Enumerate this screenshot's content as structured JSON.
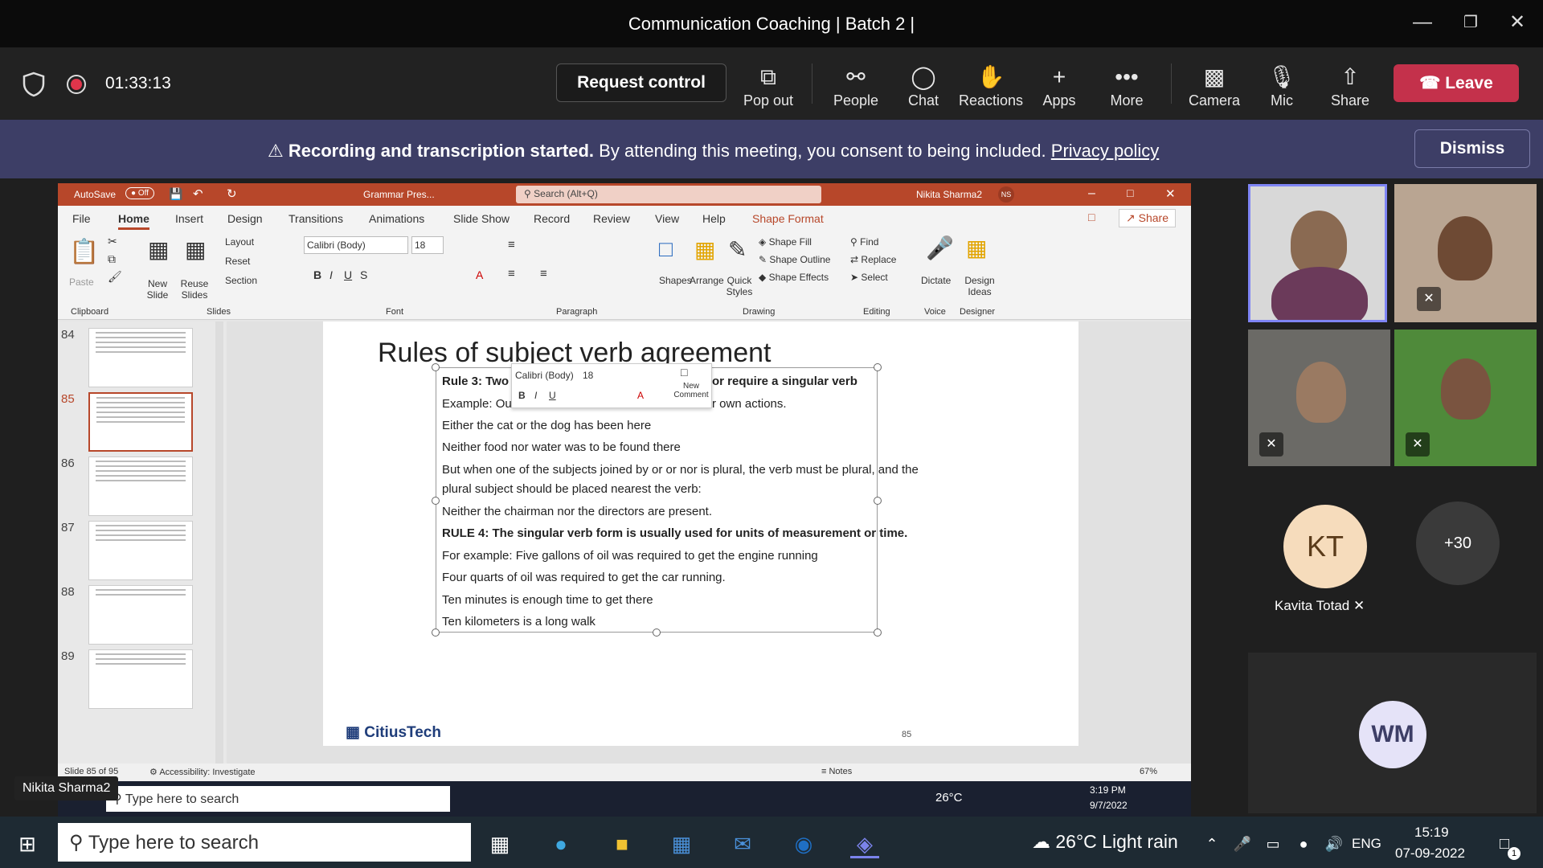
{
  "window": {
    "title": "Communication Coaching | Batch 2 |"
  },
  "meeting": {
    "timer": "01:33:13",
    "request_control": "Request control",
    "buttons": [
      {
        "label": "Pop out",
        "icon": "pop-out-icon"
      },
      {
        "label": "People",
        "icon": "people-icon"
      },
      {
        "label": "Chat",
        "icon": "chat-icon"
      },
      {
        "label": "Reactions",
        "icon": "reactions-icon"
      },
      {
        "label": "Apps",
        "icon": "apps-icon"
      },
      {
        "label": "More",
        "icon": "more-icon"
      },
      {
        "label": "Camera",
        "icon": "camera-off-icon"
      },
      {
        "label": "Mic",
        "icon": "mic-off-icon"
      },
      {
        "label": "Share",
        "icon": "share-icon"
      }
    ],
    "leave": "Leave"
  },
  "banner": {
    "bold": "Recording and transcription started.",
    "text": "By attending this meeting, you consent to being included.",
    "link": "Privacy policy",
    "dismiss": "Dismiss"
  },
  "presenter": {
    "name": "Nikita Sharma2"
  },
  "powerpoint": {
    "autosave": "AutoSave",
    "autosave_state": "Off",
    "doc_title": "Grammar Pres...",
    "search": "Search (Alt+Q)",
    "user": "Nikita Sharma2",
    "user_initials": "NS",
    "share": "Share",
    "tabs": [
      "File",
      "Home",
      "Insert",
      "Design",
      "Transitions",
      "Animations",
      "Slide Show",
      "Record",
      "Review",
      "View",
      "Help",
      "Shape Format"
    ],
    "ribbon": {
      "paste": "Paste",
      "clipboard": "Clipboard",
      "new_slide": "New Slide",
      "reuse_slides": "Reuse Slides",
      "layout": "Layout",
      "reset": "Reset",
      "section": "Section",
      "slides": "Slides",
      "font_name": "Calibri (Body)",
      "font_size": "18",
      "font": "Font",
      "paragraph": "Paragraph",
      "shapes": "Shapes",
      "arrange": "Arrange",
      "quick_styles": "Quick Styles",
      "shape_fill": "Shape Fill",
      "shape_outline": "Shape Outline",
      "shape_effects": "Shape Effects",
      "drawing": "Drawing",
      "find": "Find",
      "replace": "Replace",
      "select": "Select",
      "editing": "Editing",
      "dictate": "Dictate",
      "voice": "Voice",
      "design_ideas": "Design Ideas",
      "designer": "Designer"
    },
    "thumbnails": [
      "84",
      "85",
      "86",
      "87",
      "88",
      "89"
    ],
    "slide": {
      "title": "Rules of subject verb agreement",
      "lines": [
        "Rule 3: Two or",
        "or require a singular verb",
        "Example: Our I",
        "r own actions.",
        "Either the cat or the dog has been here",
        "Neither food nor water was to be found there",
        "But when one of the subjects joined by or or nor is plural, the verb must be plural, and the",
        "plural subject should be placed nearest the verb:",
        "Neither the chairman nor the directors are present.",
        "RULE 4: The singular verb form is usually used for units of measurement or time.",
        "For example: Five gallons of oil was required to get the engine running",
        "Four quarts of oil was required to get the car running.",
        "Ten minutes is enough time to get there",
        "Ten kilometers is a long walk"
      ],
      "mini_font": "Calibri (Body)",
      "mini_size": "18",
      "new_comment": "New Comment",
      "footer_logo": "CitiusTech",
      "page_number": "85"
    },
    "status": {
      "slide_of": "Slide 85 of 95",
      "accessibility": "Accessibility: Investigate",
      "notes": "Notes",
      "zoom": "67%"
    },
    "remote_taskbar": {
      "search": "Type here to search",
      "temp": "26°C",
      "time": "3:19 PM",
      "date": "9/7/2022"
    }
  },
  "participants": {
    "kt_initials": "KT",
    "kt_name": "Kavita Totad",
    "overflow": "+30",
    "wm_initials": "WM"
  },
  "taskbar": {
    "search": "Type here to search",
    "weather": "26°C Light rain",
    "lang": "ENG",
    "time": "15:19",
    "date": "07-09-2022",
    "notifications": "1"
  }
}
